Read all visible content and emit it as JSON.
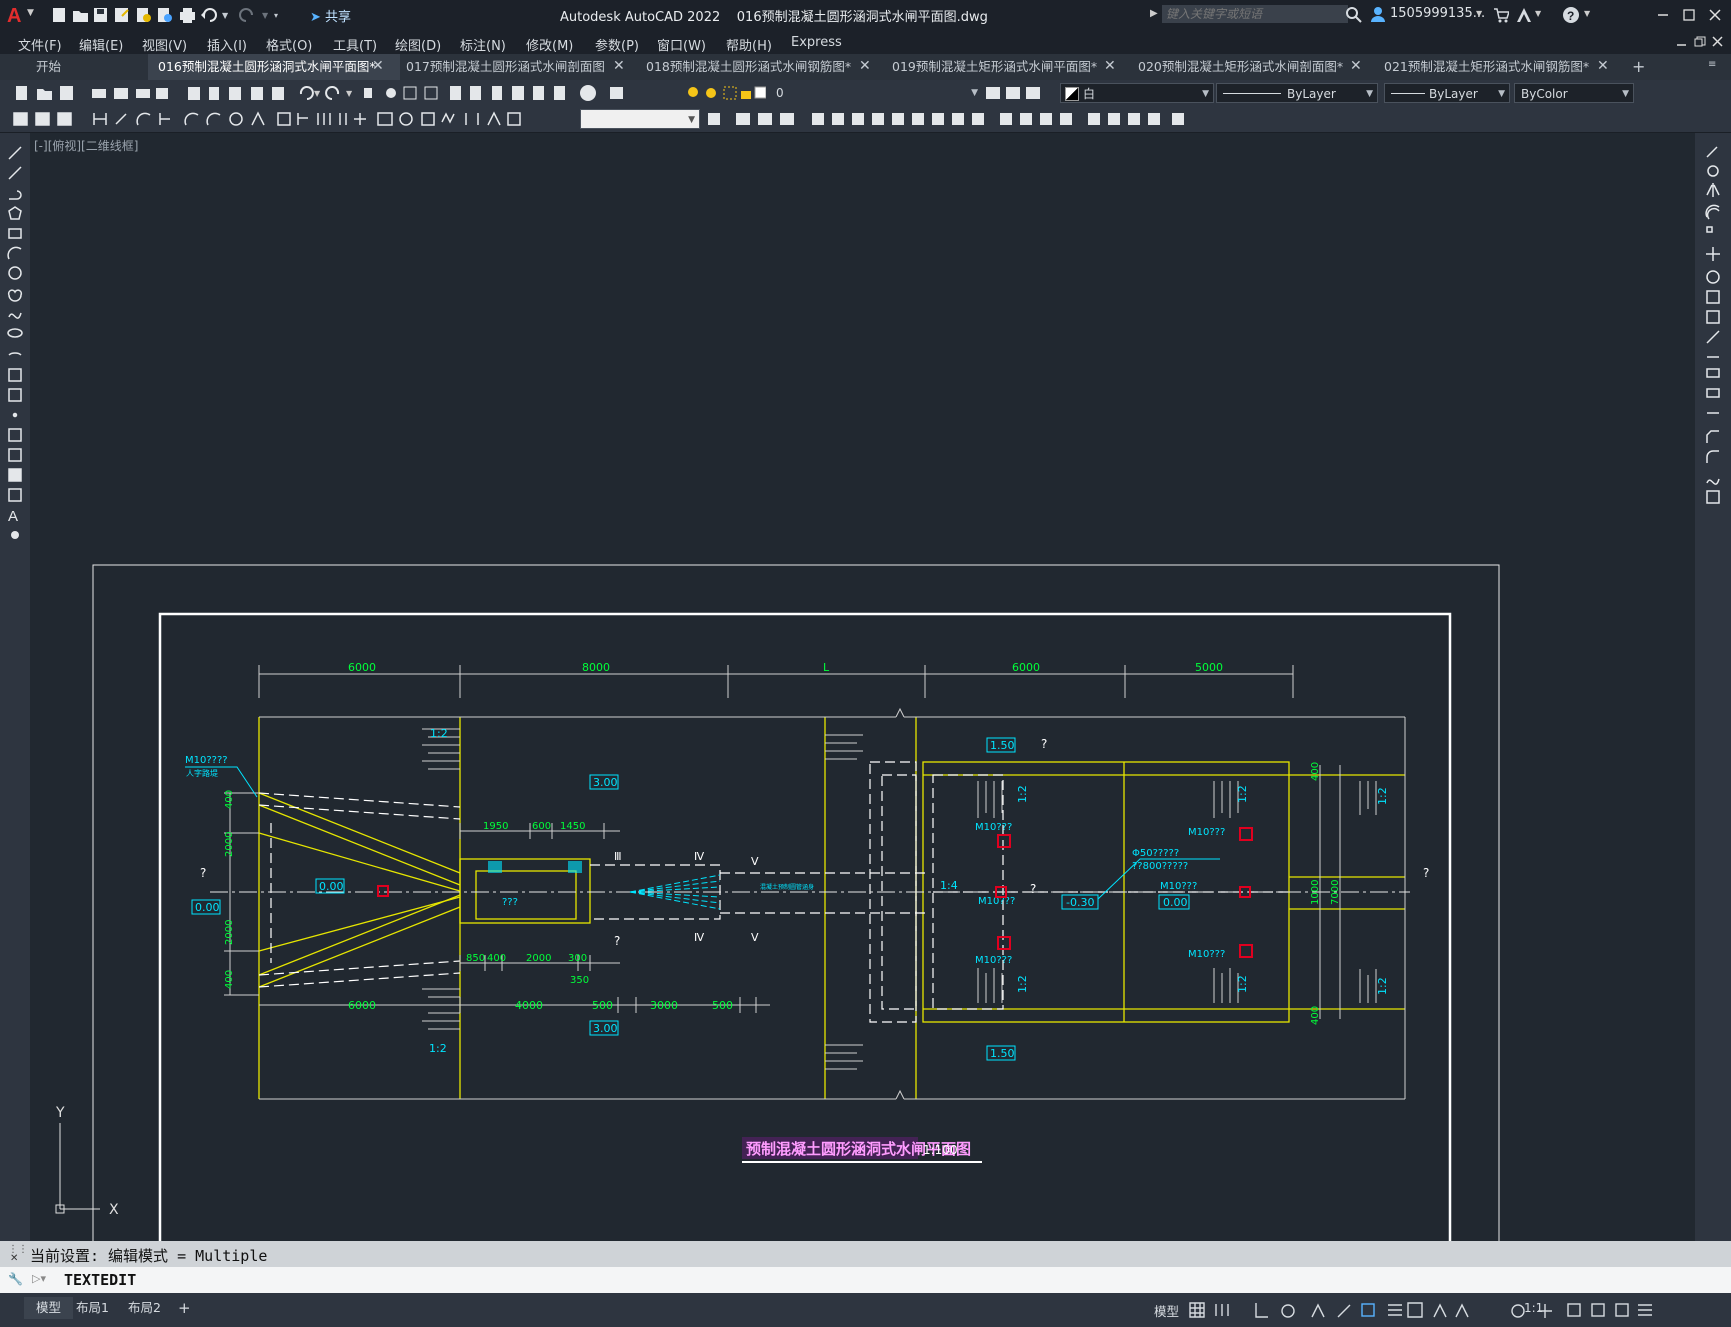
{
  "titlebar": {
    "app_icon": "autocad-a-logo",
    "share_label": "共享",
    "title": "Autodesk AutoCAD 2022    016预制混凝土圆形涵洞式水闸平面图.dwg",
    "search_placeholder": "键入关键字或短语",
    "user": "1505999135...",
    "icons": [
      "new-icon",
      "open-icon",
      "save-icon",
      "saveas-icon",
      "open-web-icon",
      "save-web-icon",
      "plot-icon",
      "undo-icon",
      "redo-icon",
      "share-icon",
      "search-icon",
      "user-icon",
      "cart-icon",
      "a360-icon",
      "help-icon",
      "minimize-icon",
      "maximize-icon",
      "close-icon"
    ]
  },
  "menu": {
    "items": [
      "文件(F)",
      "编辑(E)",
      "视图(V)",
      "插入(I)",
      "格式(O)",
      "工具(T)",
      "绘图(D)",
      "标注(N)",
      "修改(M)",
      "参数(P)",
      "窗口(W)",
      "帮助(H)",
      "Express"
    ]
  },
  "tabs": {
    "items": [
      {
        "label": "开始",
        "active": false,
        "closable": false
      },
      {
        "label": "016预制混凝土圆形涵洞式水闸平面图*",
        "active": true,
        "closable": true
      },
      {
        "label": "017预制混凝土圆形涵式水闸剖面图",
        "active": false,
        "closable": true
      },
      {
        "label": "018预制混凝土圆形涵式水闸钢筋图*",
        "active": false,
        "closable": true
      },
      {
        "label": "019预制混凝土矩形涵式水闸平面图*",
        "active": false,
        "closable": true
      },
      {
        "label": "020预制混凝土矩形涵式水闸剖面图*",
        "active": false,
        "closable": true
      },
      {
        "label": "021预制混凝土矩形涵式水闸钢筋图*",
        "active": false,
        "closable": true
      }
    ],
    "add_label": "+"
  },
  "toolbar": {
    "layer_value": "0",
    "color_value": "白",
    "linetype_value": "ByLayer",
    "lineweight_value": "ByLayer",
    "plotstyle_value": "ByColor",
    "dimstyle_value": ""
  },
  "viewport": {
    "label": "[-][俯视][二维线框]",
    "ucs_x": "X",
    "ucs_y": "Y"
  },
  "drawing": {
    "title": "预制混凝土圆形涵洞式水闸平面图",
    "scale": "1:100",
    "top_dims": [
      "6000",
      "8000",
      "L",
      "6000",
      "5000"
    ],
    "bottom_dims": [
      "6000",
      "4000",
      "500",
      "3000",
      "500"
    ],
    "mid_dims_top": [
      "1950",
      "600",
      "1450"
    ],
    "mid_dims_bottom": [
      "850",
      "400",
      "2000",
      "300",
      "350"
    ],
    "left_dims": [
      "400",
      "2000",
      "2000",
      "400"
    ],
    "right_dims": [
      "400",
      "1000",
      "7000",
      "400"
    ],
    "labels": {
      "m10_left": "M10????",
      "m10_left_sub": "人字路堤",
      "slope_12": "1:2",
      "slope_14": "1:4",
      "elev_300_top": "3.00",
      "elev_300_bot": "3.00",
      "elev_000_a": "0.00",
      "elev_000_b": "0.00",
      "elev_000_c": "0.00",
      "elev_150_top": "1.50",
      "elev_150_bot": "1.50",
      "elev_m030": "-0.30",
      "m10_a": "M10???",
      "m10_b": "M10???",
      "m10_c": "M10???",
      "m10_d": "M10???",
      "m10_e": "M10???",
      "m10_f": "M10???",
      "pipe": "Φ50?????",
      "pipe2": "??800?????",
      "sec3": "Ⅲ",
      "sec4": "Ⅳ",
      "sec5": "Ⅴ",
      "q": "?",
      "q3": "???",
      "sheet_text": "混凝土预制圆管涵身"
    }
  },
  "command": {
    "history": "当前设置: 编辑模式 = Multiple",
    "current": "TEXTEDIT"
  },
  "status": {
    "tabs": [
      {
        "label": "模型",
        "active": true
      },
      {
        "label": "布局1",
        "active": false
      },
      {
        "label": "布局2",
        "active": false
      }
    ],
    "add_label": "+",
    "model_label": "模型",
    "scale_label": "1:1"
  },
  "colors": {
    "green": "#00ff3a",
    "yellow": "#e6e600",
    "cyan": "#00e5ff",
    "white": "#ffffff",
    "red": "#e0001f",
    "magenta": "#ff55ff",
    "bg": "#212830"
  }
}
